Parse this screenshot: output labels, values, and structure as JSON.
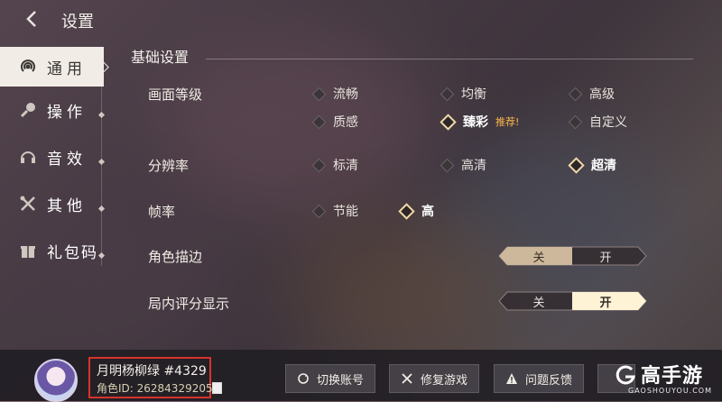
{
  "header": {
    "title": "设置"
  },
  "sidebar": {
    "items": [
      {
        "label": "通用",
        "icon": "signal-icon",
        "active": true
      },
      {
        "label": "操作",
        "icon": "controller-icon",
        "active": false
      },
      {
        "label": "音效",
        "icon": "headphones-icon",
        "active": false
      },
      {
        "label": "其他",
        "icon": "tools-icon",
        "active": false
      },
      {
        "label": "礼包码",
        "icon": "gift-icon",
        "active": false
      }
    ]
  },
  "main": {
    "section_title": "基础设置",
    "quality": {
      "label": "画面等级",
      "options": [
        "流畅",
        "均衡",
        "高级",
        "质感",
        "臻彩",
        "自定义"
      ],
      "selected": "臻彩",
      "recommended_badge": "推荐!"
    },
    "resolution": {
      "label": "分辨率",
      "options": [
        "标清",
        "高清",
        "超清"
      ],
      "selected": "超清"
    },
    "framerate": {
      "label": "帧率",
      "options": [
        "节能",
        "高"
      ],
      "selected": "高"
    },
    "outline": {
      "label": "角色描边",
      "off": "关",
      "on": "开",
      "value": "关"
    },
    "score_display": {
      "label": "局内评分显示",
      "off": "关",
      "on": "开",
      "value": "开"
    }
  },
  "footer": {
    "username": "月明杨柳绿 #4329",
    "user_id": "角色ID: 26284329205",
    "buttons": {
      "switch_account": "切换账号",
      "repair_game": "修复游戏",
      "feedback": "问题反馈"
    }
  },
  "watermark": {
    "name": "高手游",
    "url": "GAOSHOUYOU.COM"
  },
  "colors": {
    "accent_gold": "#f0d8a8",
    "badge": "#ffb74a",
    "highlight_box": "#d8332b",
    "toggle_active": "#fff3d6"
  }
}
